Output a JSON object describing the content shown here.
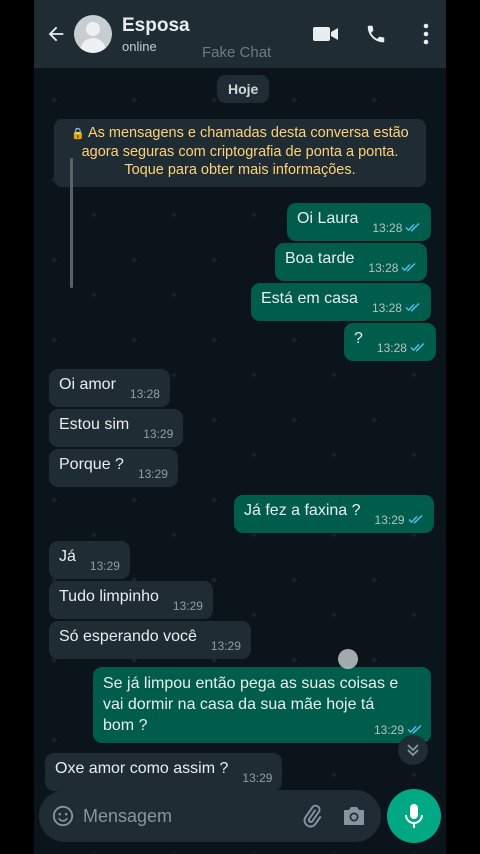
{
  "header": {
    "contact_name": "Esposa",
    "status": "online",
    "watermark": "Fake Chat"
  },
  "date_chip": "Hoje",
  "encryption_notice": "As mensagens e chamadas desta conversa estão agora seguras com criptografia de ponta a ponta. Toque para obter mais informações.",
  "messages": [
    {
      "dir": "out",
      "text": "Oi Laura",
      "time": "13:28",
      "status": "read"
    },
    {
      "dir": "out",
      "text": "Boa tarde",
      "time": "13:28",
      "status": "read"
    },
    {
      "dir": "out",
      "text": "Está em casa",
      "time": "13:28",
      "status": "read"
    },
    {
      "dir": "out",
      "text": "?",
      "time": "13:28",
      "status": "read"
    },
    {
      "dir": "in",
      "text": "Oi amor",
      "time": "13:28"
    },
    {
      "dir": "in",
      "text": "Estou sim",
      "time": "13:29"
    },
    {
      "dir": "in",
      "text": "Porque ?",
      "time": "13:29"
    },
    {
      "dir": "out",
      "text": "Já fez a faxina ?",
      "time": "13:29",
      "status": "read"
    },
    {
      "dir": "in",
      "text": "Já",
      "time": "13:29"
    },
    {
      "dir": "in",
      "text": "Tudo limpinho",
      "time": "13:29"
    },
    {
      "dir": "in",
      "text": "Só esperando você",
      "time": "13:29"
    },
    {
      "dir": "out",
      "text": "Se já limpou então pega as suas coisas e vai dormir na casa da sua mãe hoje tá bom ?",
      "time": "13:29",
      "status": "read"
    },
    {
      "dir": "in",
      "text": "Oxe amor como assim ?",
      "time": "13:29"
    }
  ],
  "input": {
    "placeholder": "Mensagem"
  },
  "colors": {
    "outgoing_bubble": "#005c4b",
    "incoming_bubble": "#1f2c34",
    "background": "#0b141a",
    "accent": "#00a884",
    "read_ticks": "#53bdeb",
    "encryption_text": "#ffd279"
  },
  "icons": {
    "back": "arrow-left-icon",
    "video": "video-call-icon",
    "call": "phone-icon",
    "menu": "more-vertical-icon",
    "emoji": "emoji-icon",
    "attach": "paperclip-icon",
    "camera": "camera-icon",
    "mic": "microphone-icon",
    "scroll": "chevron-double-down-icon"
  }
}
